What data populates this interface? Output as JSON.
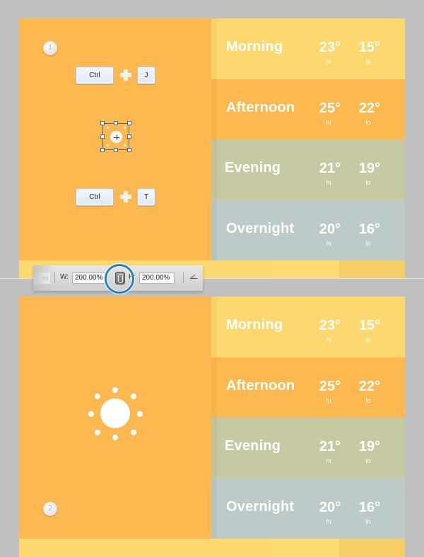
{
  "colors": {
    "background": "#c0c0c0",
    "panel_orange": "#fdb94f",
    "morning": "#fdd86f",
    "afternoon": "#fdb94f",
    "evening": "#c7c9a2",
    "overnight": "#bccbc9",
    "strip": [
      "#fdd96f",
      "#fddb73",
      "#f6cf69"
    ],
    "highlight": "#2a7fc4"
  },
  "steps": [
    {
      "number": "1"
    },
    {
      "number": "2"
    }
  ],
  "shortcuts": [
    {
      "modifier": "Ctrl",
      "key": "J"
    },
    {
      "modifier": "Ctrl",
      "key": "T"
    }
  ],
  "icons": {
    "plus": "plus-icon",
    "transform_box": "transform-bounding-box-icon",
    "sun": "sun-icon",
    "link": "link-chain-icon",
    "angle": "angle-icon"
  },
  "options_bar": {
    "prev_field_fragment": "px",
    "width_label": "W:",
    "width_value": "200.00%",
    "height_label": "H:",
    "height_value": "200.00%"
  },
  "forecast": {
    "hi_label": "hi",
    "lo_label": "lo",
    "rows": [
      {
        "period": "Morning",
        "hi": "23°",
        "lo": "15°"
      },
      {
        "period": "Afternoon",
        "hi": "25°",
        "lo": "22°"
      },
      {
        "period": "Evening",
        "hi": "21°",
        "lo": "19°"
      },
      {
        "period": "Overnight",
        "hi": "20°",
        "lo": "16°"
      }
    ]
  }
}
